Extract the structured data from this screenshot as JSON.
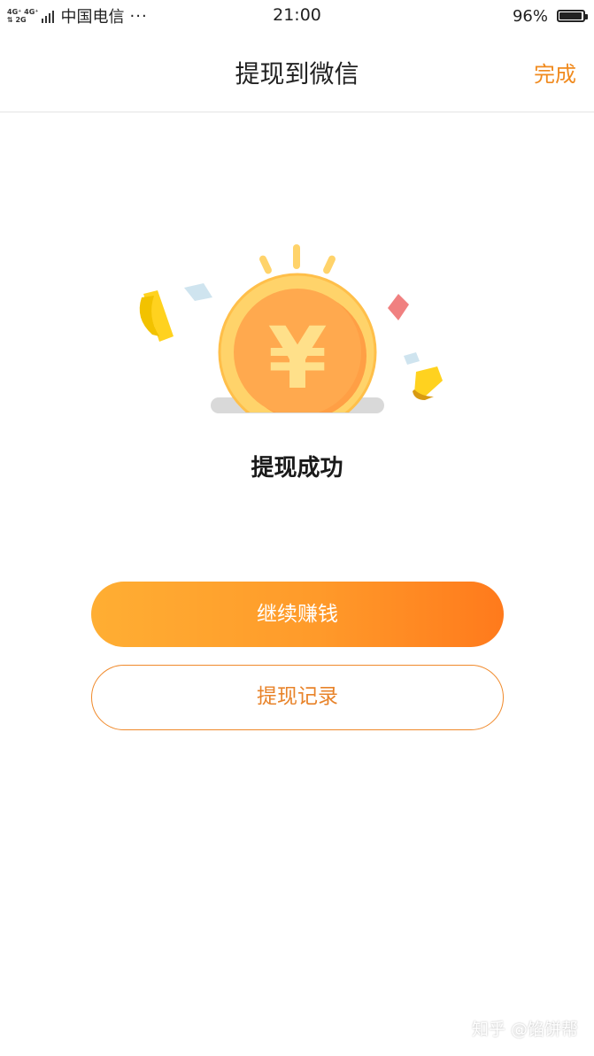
{
  "status_bar": {
    "network_top": "4G⁺ 4G⁺",
    "network_bottom": "⇅  2G",
    "carrier": "中国电信",
    "more": "···",
    "time": "21:00",
    "battery_percent": "96%",
    "battery_level": 0.96
  },
  "nav": {
    "title": "提现到微信",
    "done_label": "完成"
  },
  "result": {
    "icon": "coin-yen-icon",
    "currency_symbol": "¥",
    "message": "提现成功"
  },
  "actions": {
    "primary_label": "继续赚钱",
    "secondary_label": "提现记录"
  },
  "watermark": "知乎 @馅饼帮",
  "colors": {
    "accent": "#f08a1e",
    "gradient_start": "#ffae33",
    "gradient_end": "#ff7a1c",
    "coin_outer": "#ffd36a",
    "coin_inner": "#ff9f45"
  }
}
